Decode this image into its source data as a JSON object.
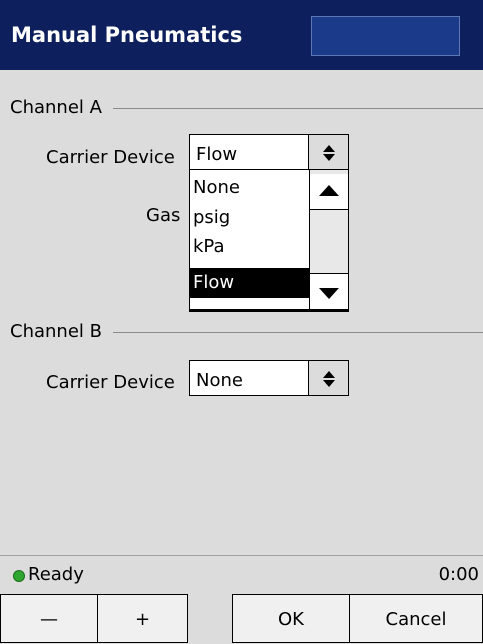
{
  "window": {
    "title": "Manual Pneumatics"
  },
  "channel_a": {
    "label": "Channel A",
    "carrier_device_label": "Carrier Device",
    "carrier_device_value": "Flow",
    "gas_label": "Gas",
    "dropdown_options": [
      "None",
      "psig",
      "kPa",
      "Flow"
    ],
    "dropdown_selected": "Flow"
  },
  "channel_b": {
    "label": "Channel B",
    "carrier_device_label": "Carrier Device",
    "carrier_device_value": "None"
  },
  "status": {
    "text": "Ready",
    "time": "0:00",
    "indicator_color": "#2fa62f"
  },
  "buttons": {
    "minus": "—",
    "plus": "+",
    "ok": "OK",
    "cancel": "Cancel"
  },
  "colors": {
    "title_bar": "#0d1f5c",
    "background": "#dcdcdc"
  }
}
